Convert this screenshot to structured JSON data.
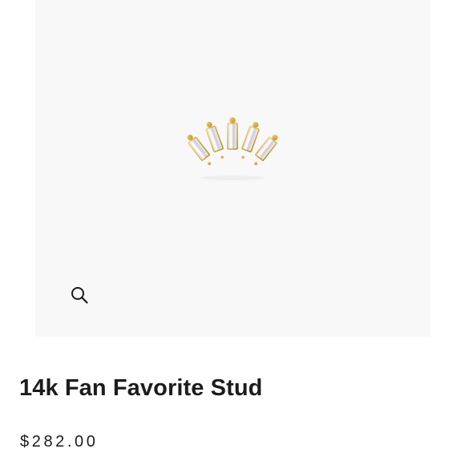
{
  "product": {
    "title": "14k Fan Favorite Stud",
    "price": "$282.00",
    "image_alt": "gold-earring-with-five-baguette-stones"
  },
  "gallery": {
    "zoom_icon": "magnifier-icon"
  },
  "colors": {
    "image_background": "#f8f8f8",
    "gold": "#d9b24a",
    "text": "#1c1c1c"
  }
}
